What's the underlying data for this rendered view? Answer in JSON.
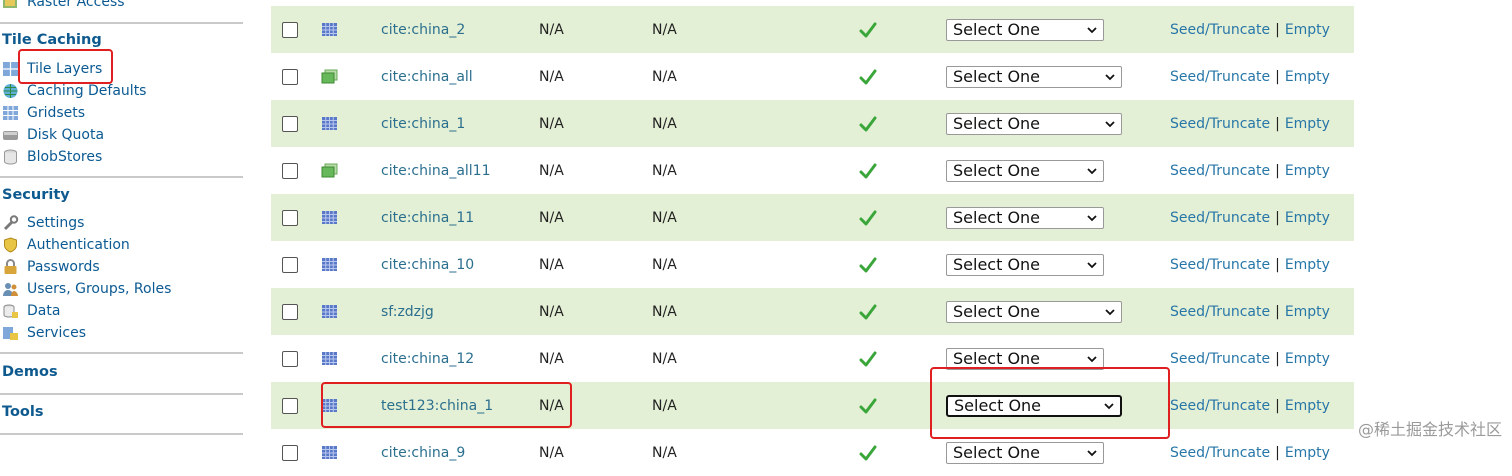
{
  "sidebar": {
    "top_item": "Raster Access",
    "tile_caching": {
      "heading": "Tile Caching",
      "items": [
        "Tile Layers",
        "Caching Defaults",
        "Gridsets",
        "Disk Quota",
        "BlobStores"
      ]
    },
    "security": {
      "heading": "Security",
      "items": [
        "Settings",
        "Authentication",
        "Passwords",
        "Users, Groups, Roles",
        "Data",
        "Services"
      ]
    },
    "demos": "Demos",
    "tools": "Tools"
  },
  "table": {
    "rows": [
      {
        "name": "cite:china_2",
        "col1": "N/A",
        "col2": "N/A",
        "select": "Select One",
        "icon": "raster-layer-icon"
      },
      {
        "name": "cite:china_all",
        "col1": "N/A",
        "col2": "N/A",
        "select": "Select One",
        "icon": "layer-group-icon"
      },
      {
        "name": "cite:china_1",
        "col1": "N/A",
        "col2": "N/A",
        "select": "Select One",
        "icon": "raster-layer-icon"
      },
      {
        "name": "cite:china_all11",
        "col1": "N/A",
        "col2": "N/A",
        "select": "Select One",
        "icon": "layer-group-icon"
      },
      {
        "name": "cite:china_11",
        "col1": "N/A",
        "col2": "N/A",
        "select": "Select One",
        "icon": "raster-layer-icon"
      },
      {
        "name": "cite:china_10",
        "col1": "N/A",
        "col2": "N/A",
        "select": "Select One",
        "icon": "raster-layer-icon"
      },
      {
        "name": "sf:zdzjg",
        "col1": "N/A",
        "col2": "N/A",
        "select": "Select One",
        "icon": "raster-layer-icon"
      },
      {
        "name": "cite:china_12",
        "col1": "N/A",
        "col2": "N/A",
        "select": "Select One",
        "icon": "raster-layer-icon"
      },
      {
        "name": "test123:china_1",
        "col1": "N/A",
        "col2": "N/A",
        "select": "Select One",
        "icon": "raster-layer-icon"
      },
      {
        "name": "cite:china_9",
        "col1": "N/A",
        "col2": "N/A",
        "select": "Select One",
        "icon": "raster-layer-icon"
      }
    ],
    "seed_label": "Seed/Truncate",
    "separator": "|",
    "empty_label": "Empty"
  },
  "watermark": "@稀土掘金技术社区",
  "colors": {
    "row_highlight": "#e4f0d5",
    "link": "#2776a8",
    "annotation": "#e02020",
    "check": "#3aa63a"
  }
}
